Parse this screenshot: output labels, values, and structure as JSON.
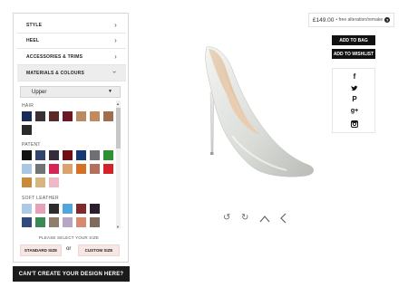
{
  "accordion": [
    {
      "label": "STYLE"
    },
    {
      "label": "HEEL"
    },
    {
      "label": "ACCESSORIES & TRIMS"
    },
    {
      "label": "MATERIALS & COLOURS"
    }
  ],
  "material_select": {
    "value": "Upper"
  },
  "sections": {
    "hair": {
      "label": "HAIR"
    },
    "patent": {
      "label": "PATENT"
    },
    "soft_leather": {
      "label": "SOFT LEATHER"
    }
  },
  "swatch_colors": {
    "hair": [
      "#1c2a5b",
      "#3b3036",
      "#5a2a26",
      "#6d1624",
      "#b88b63",
      "#c38a5c",
      "#a06d4d",
      "#6b5545",
      "#2b2b2b"
    ],
    "patent": [
      "#121212",
      "#32456d",
      "#342c3b",
      "#6f0f14",
      "#183a73",
      "#6f6f74",
      "#2f8f33",
      "#a9c6e3",
      "#6f7373",
      "#d62456",
      "#dca26d",
      "#d76f25",
      "#b56f5d",
      "#d4222a",
      "#c98a3b",
      "#d7b57e",
      "#f0b7c5"
    ],
    "soft_leather": [
      "#aec9e4",
      "#e6a0b8",
      "#2c2c2c",
      "#51a5d9",
      "#7f2a2f",
      "#2a1e2a",
      "#324a7a",
      "#3a8a56",
      "#8f7e6c",
      "#b7a5c4",
      "#d48b6f",
      "#7f6a5e"
    ]
  },
  "size": {
    "prompt": "PLEASE SELECT YOUR SIZE",
    "standard": "STANDARD SIZE",
    "or": "or",
    "custom": "CUSTOM SIZE"
  },
  "cant_create": "CAN'T CREATE YOUR DESIGN HERE?",
  "price": {
    "amount": "£149.00",
    "note": "• free alteration/remake"
  },
  "add_to_bag": "ADD TO BAG",
  "add_to_wishlist": "ADD TO WISHLIST",
  "social_icons": [
    "facebook-icon",
    "twitter-icon",
    "pinterest-icon",
    "google-plus-icon",
    "instagram-icon"
  ],
  "view_controls": [
    "rotate-left-icon",
    "rotate-right-icon",
    "view-top-icon",
    "view-side-icon"
  ]
}
